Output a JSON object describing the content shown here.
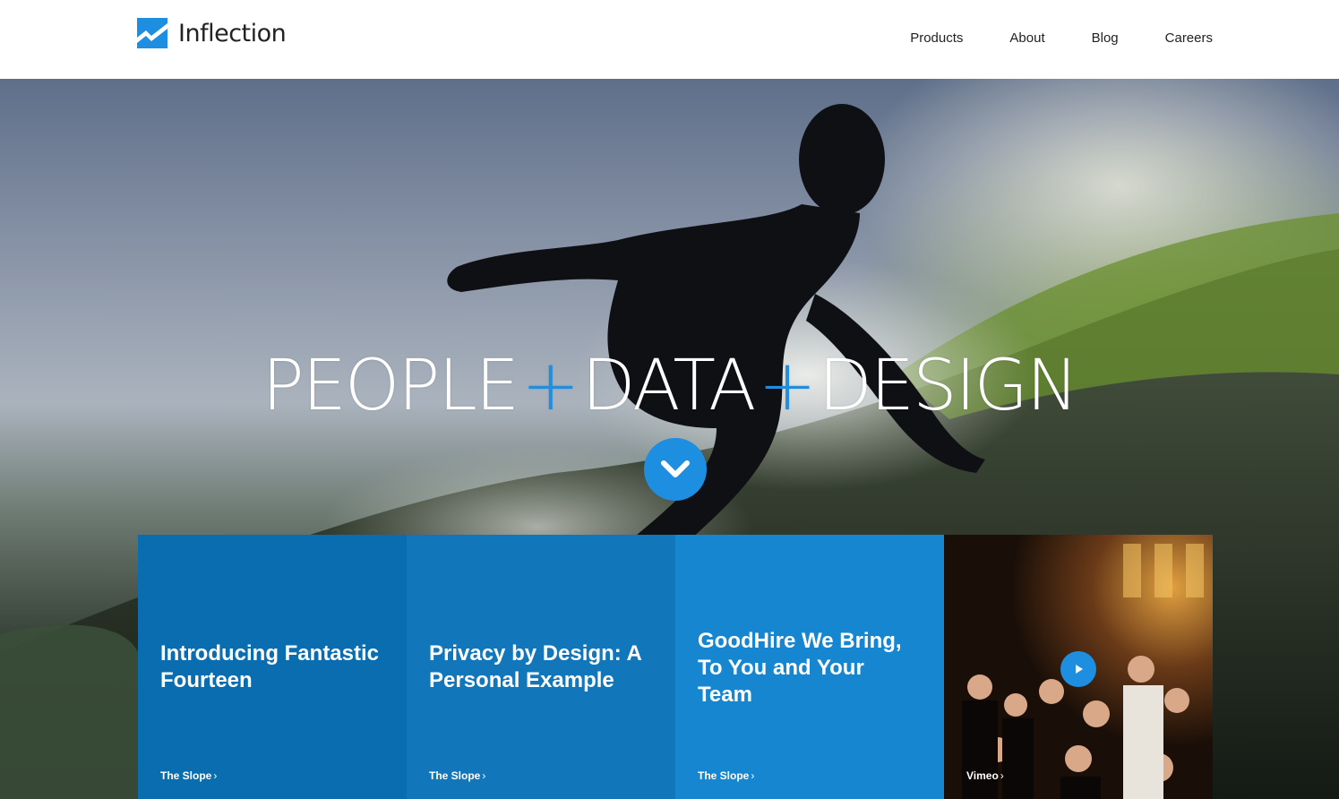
{
  "brand": {
    "name": "Inflection",
    "accent": "#1e8ee0"
  },
  "nav": {
    "items": [
      "Products",
      "About",
      "Blog",
      "Careers"
    ]
  },
  "hero": {
    "words": [
      "PEOPLE",
      "DATA",
      "DESIGN"
    ],
    "separator": "+",
    "scroll_icon": "chevron-down-icon"
  },
  "cards": [
    {
      "title": "Introducing Fantastic Fourteen",
      "source": "The Slope",
      "chevron": "›"
    },
    {
      "title": "Privacy by Design: A Personal Example",
      "source": "The Slope",
      "chevron": "›"
    },
    {
      "title": "GoodHire We Bring, To You and Your Team",
      "source": "The Slope",
      "chevron": "›"
    },
    {
      "title": "",
      "source": "Vimeo",
      "chevron": "›",
      "icon": "play-icon"
    }
  ]
}
